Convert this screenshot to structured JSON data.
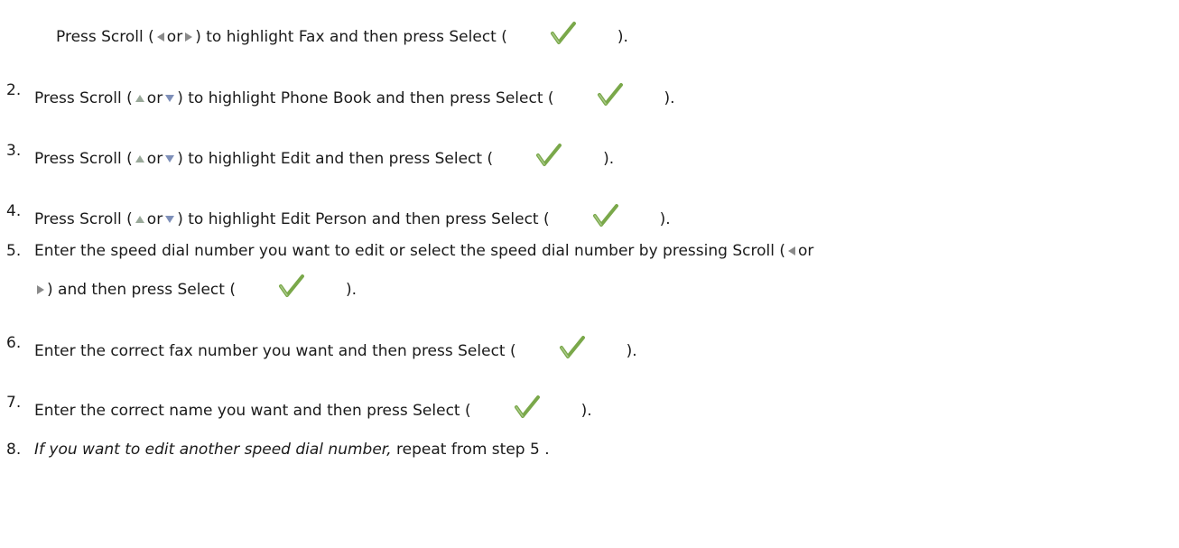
{
  "steps": [
    {
      "num": "",
      "pre": "Press Scroll (",
      "or": "or",
      "mid": ") to highlight Fax and then press Select (",
      "post": ")."
    },
    {
      "num": "2.",
      "pre": "Press Scroll (",
      "or": "or",
      "mid": ") to highlight Phone Book and then press Select (",
      "post": ")."
    },
    {
      "num": "3.",
      "pre": "Press Scroll (",
      "or": "or",
      "mid": ") to highlight Edit and then press Select (",
      "post": ")."
    },
    {
      "num": "4.",
      "pre": "Press Scroll (",
      "or": "or",
      "mid": ") to highlight Edit Person and then press Select (",
      "post": ")."
    },
    {
      "num": "5.",
      "line1": "Enter the speed dial number you want to edit or select the speed dial number by pressing Scroll (",
      "or": "or",
      "line2_mid": ") and then press Select (",
      "post": ")."
    },
    {
      "num": "6.",
      "text": "Enter the correct fax number you want and then press Select (",
      "post": ")."
    },
    {
      "num": "7.",
      "text": "Enter the correct name you want and then press Select (",
      "post": ")."
    },
    {
      "num": "8.",
      "italic": "If you want to edit another speed dial number,",
      "text": " repeat from step 5 ."
    }
  ],
  "icons": {
    "scroll_left": "left-arrow-icon",
    "scroll_right": "right-arrow-icon",
    "scroll_up": "up-arrow-icon",
    "scroll_down": "down-arrow-icon",
    "select": "checkmark-icon"
  },
  "colors": {
    "text": "#1a1a1a",
    "check": "#7aa84a"
  }
}
